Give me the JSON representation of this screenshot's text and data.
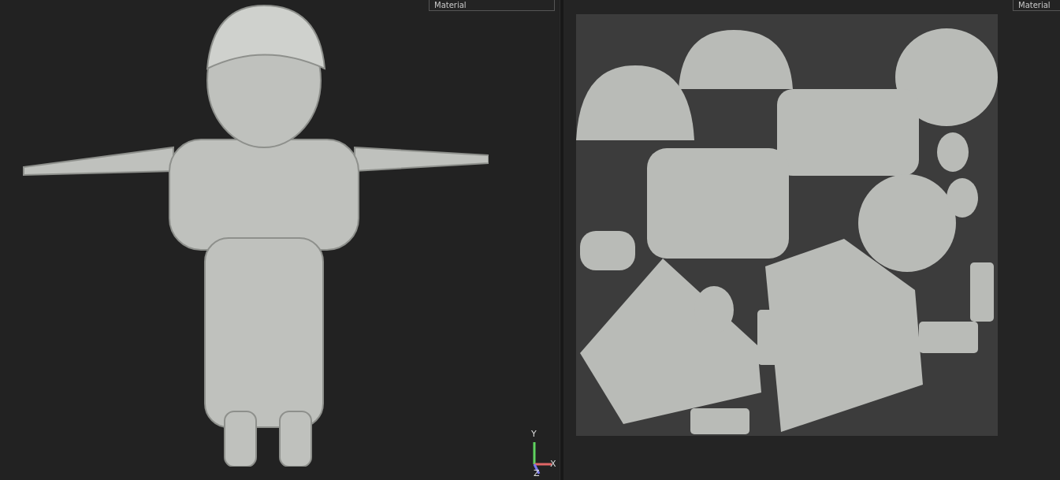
{
  "viewports": [
    {
      "kind": "model",
      "material_dropdown": "Material",
      "axes": {
        "y": "Y",
        "x": "X",
        "z": "Z"
      }
    },
    {
      "kind": "uv",
      "material_dropdown": "Material"
    }
  ]
}
